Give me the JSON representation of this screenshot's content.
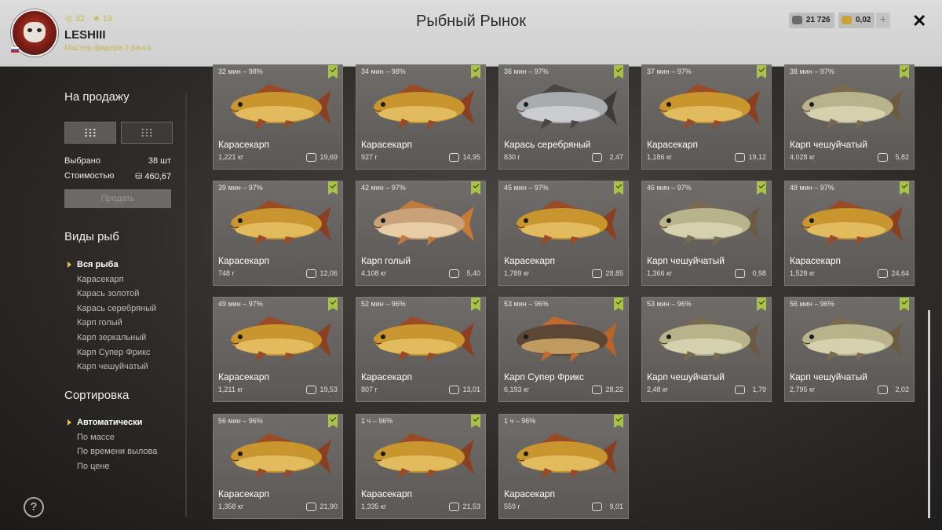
{
  "header": {
    "title": "Рыбный Рынок",
    "player": {
      "name": "LESHIII",
      "rank": "Мастер фидера 2 ранга",
      "level": "32",
      "stars": "19"
    },
    "silver": "21 726",
    "gold": "0,02",
    "plus": "+",
    "close": "✕"
  },
  "sidebar": {
    "for_sale_title": "На продажу",
    "selected_label": "Выбрано",
    "selected_value": "38 шт",
    "cost_label": "Стоимостью",
    "cost_value": "460,67",
    "sell_button": "Продать",
    "fish_types_title": "Виды рыб",
    "fish_types": [
      "Вся рыба",
      "Карасекарп",
      "Карась золотой",
      "Карась серебряный",
      "Карп голый",
      "Карп зеркальный",
      "Карп Супер Фрикс",
      "Карп чешуйчатый"
    ],
    "sort_title": "Сортировка",
    "sort_options": [
      "Автоматически",
      "По массе",
      "По времени вылова",
      "По цене"
    ],
    "help": "?"
  },
  "colors": {
    "accent_yellow": "#e2c04a",
    "check_green": "#a9c24a",
    "header_bg": "#d6d6d6"
  },
  "cards": [
    {
      "time": "32 мин – 98%",
      "name": "Карасекарп",
      "weight": "1,221 кг",
      "price": "19,69",
      "kind": "golden"
    },
    {
      "time": "34 мин – 98%",
      "name": "Карасекарп",
      "weight": "927 г",
      "price": "14,95",
      "kind": "golden"
    },
    {
      "time": "36 мин – 97%",
      "name": "Карась серебряный",
      "weight": "830 г",
      "price": "2,47",
      "kind": "silver"
    },
    {
      "time": "37 мин – 97%",
      "name": "Карасекарп",
      "weight": "1,186 кг",
      "price": "19,12",
      "kind": "golden"
    },
    {
      "time": "38 мин – 97%",
      "name": "Карп чешуйчатый",
      "weight": "4,028 кг",
      "price": "5,82",
      "kind": "scaled"
    },
    {
      "time": "39 мин – 97%",
      "name": "Карасекарп",
      "weight": "748 г",
      "price": "12,06",
      "kind": "golden"
    },
    {
      "time": "42 мин – 97%",
      "name": "Карп голый",
      "weight": "4,108 кг",
      "price": "5,40",
      "kind": "leather"
    },
    {
      "time": "45 мин – 97%",
      "name": "Карасекарп",
      "weight": "1,789 кг",
      "price": "28,85",
      "kind": "golden"
    },
    {
      "time": "46 мин – 97%",
      "name": "Карп чешуйчатый",
      "weight": "1,366 кг",
      "price": "0,98",
      "kind": "scaled"
    },
    {
      "time": "48 мин – 97%",
      "name": "Карасекарп",
      "weight": "1,528 кг",
      "price": "24,64",
      "kind": "golden"
    },
    {
      "time": "49 мин – 97%",
      "name": "Карасекарп",
      "weight": "1,211 кг",
      "price": "19,53",
      "kind": "golden"
    },
    {
      "time": "52 мин – 96%",
      "name": "Карасекарп",
      "weight": "807 г",
      "price": "13,01",
      "kind": "golden"
    },
    {
      "time": "53 мин – 96%",
      "name": "Карп Супер Фрикс",
      "weight": "6,193 кг",
      "price": "28,22",
      "kind": "frix"
    },
    {
      "time": "53 мин – 96%",
      "name": "Карп чешуйчатый",
      "weight": "2,48 кг",
      "price": "1,79",
      "kind": "scaled"
    },
    {
      "time": "56 мин – 96%",
      "name": "Карп чешуйчатый",
      "weight": "2,795 кг",
      "price": "2,02",
      "kind": "scaled"
    },
    {
      "time": "56 мин – 96%",
      "name": "Карасекарп",
      "weight": "1,358 кг",
      "price": "21,90",
      "kind": "golden"
    },
    {
      "time": "1 ч – 96%",
      "name": "Карасекарп",
      "weight": "1,335 кг",
      "price": "21,53",
      "kind": "golden"
    },
    {
      "time": "1 ч – 96%",
      "name": "Карасекарп",
      "weight": "559 г",
      "price": "9,01",
      "kind": "golden"
    }
  ]
}
